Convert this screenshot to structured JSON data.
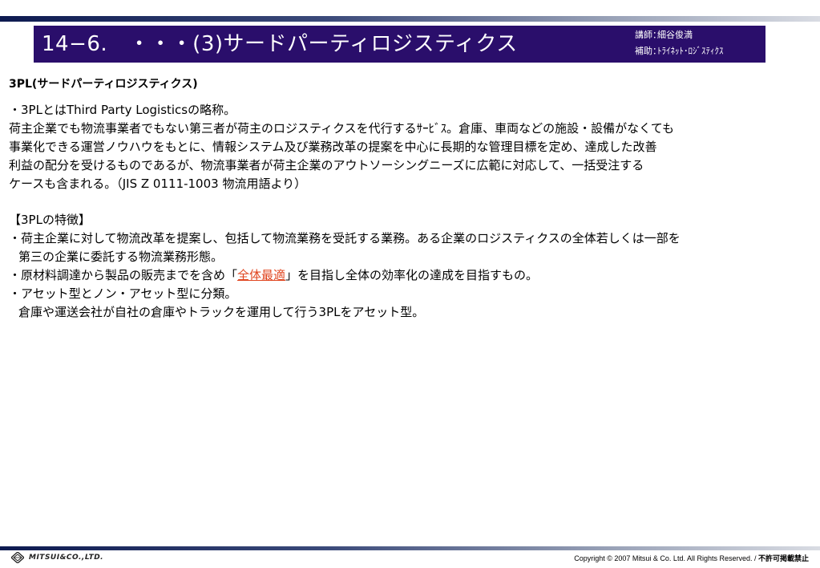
{
  "header": {
    "title": "14−6.　・・・(3)サードパーティロジスティクス",
    "lecturer_label": "講師：",
    "lecturer_name": "細谷俊満",
    "assistant_label": "補助：",
    "assistant_name": "ﾄﾗｲﾈｯﾄ･ﾛｼﾞｽﾃｨｸｽ"
  },
  "content": {
    "heading": "3PL(サードパーティロジスティクス)",
    "definition": [
      "・3PLとはThird Party Logisticsの略称。",
      "荷主企業でも物流事業者でもない第三者が荷主のロジスティクスを代行するｻｰﾋﾞｽ。倉庫、車両などの施設・設備がなくても",
      "事業化できる運営ノウハウをもとに、情報システム及び業務改革の提案を中心に長期的な管理目標を定め、達成した改善",
      "利益の配分を受けるものであるが、物流事業者が荷主企業のアウトソーシングニーズに広範に対応して、一括受注する",
      "ケースも含まれる。（JIS Z 0111-1003 物流用語より）"
    ],
    "features_heading": "【3PLの特徴】",
    "feature1_line1": "・荷主企業に対して物流改革を提案し、包括して物流業務を受託する業務。ある企業のロジスティクスの全体若しくは一部を",
    "feature1_line2": "第三の企業に委託する物流業務形態。",
    "feature2_pre": "・原材料調達から製品の販売までを含め「",
    "feature2_highlight": "全体最適",
    "feature2_post": "」を目指し全体の効率化の達成を目指すもの。",
    "feature3_line1": "・アセット型とノン・アセット型に分類。",
    "feature3_line2": "倉庫や運送会社が自社の倉庫やトラックを運用して行う3PLをアセット型。"
  },
  "footer": {
    "logo_text": "MITSUI&CO.,LTD.",
    "logo_icon": "mitsui-diamond-icon",
    "copyright": "Copyright © 2007 Mitsui & Co. Ltd. All Rights Reserved. / ",
    "copyright_bold": "不許可掲載禁止"
  },
  "colors": {
    "title_bar": "#2a0e6b",
    "highlight": "#e0451f"
  }
}
